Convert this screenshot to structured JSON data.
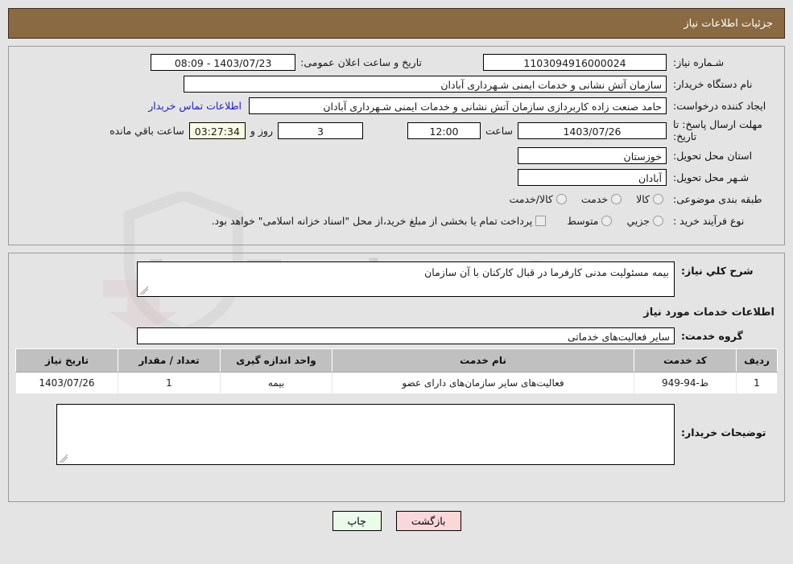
{
  "header": {
    "title": "جزئیات اطلاعات نیاز"
  },
  "form": {
    "need_number_label": "شـماره نیاز:",
    "need_number_value": "1103094916000024",
    "announce_label": "تاریخ و ساعت اعلان عمومی:",
    "announce_value": "1403/07/23 - 08:09",
    "buyer_org_label": "نام دستگاه خریدار:",
    "buyer_org_value": "سازمان آتش نشانی و خدمات ایمنی شـهرداری آبادان",
    "creator_label": "ایجاد کننده درخواست:",
    "creator_value": "حامد صنعت زاده کاربردازی سازمان آتش نشانی و خدمات ایمنی شـهرداری آبادان",
    "contact_link": "اطلاعات تماس خریدار",
    "deadline_label": "مهلت ارسال پاسخ: تا تاریخ:",
    "deadline_date": "1403/07/26",
    "hour_label": "ساعت",
    "deadline_time": "12:00",
    "days_value": "3",
    "days_label": "روز و",
    "countdown_value": "03:27:34",
    "remaining_label": "ساعت باقي مانده",
    "province_label": "استان محل تحویل:",
    "province_value": "خوزستان",
    "city_label": "شـهر محل تحویل:",
    "city_value": "آبادان",
    "category_label": "طبقه بندی موضوعی:",
    "category_options": [
      {
        "label": "کالا",
        "selected": false
      },
      {
        "label": "خدمت",
        "selected": false
      },
      {
        "label": "کالا/خدمت",
        "selected": false
      }
    ],
    "process_label": "نوع فرآیند خرید :",
    "process_options": [
      {
        "label": "جزیي",
        "selected": false
      },
      {
        "label": "متوسط",
        "selected": false
      }
    ],
    "treasury_checkbox_label": "پرداخت تمام یا بخشی از مبلغ خرید،از محل \"اسناد خزانه اسلامی\" خواهد بود.",
    "treasury_checked": false
  },
  "description": {
    "label": "شرح کلي نیاز:",
    "value": "بیمه مسئولیت مدنی کارفرما در قبال کارکنان با آن سازمان"
  },
  "services": {
    "section_title": "اطلاعات خدمات مورد نیاز",
    "group_label": "گروه خدمت:",
    "group_value": "سایر فعالیت‌های خدماتی",
    "columns": [
      "ردیف",
      "کد خدمت",
      "نام خدمت",
      "واحد اندازه گیری",
      "تعداد / مقدار",
      "تاریخ نیاز"
    ],
    "rows": [
      {
        "index": "1",
        "code": "ط-94-949",
        "name": "فعالیت‌های سایر سازمان‌های دارای عضو",
        "unit": "بیمه",
        "quantity": "1",
        "date": "1403/07/26"
      }
    ]
  },
  "buyer_notes": {
    "label": "توضیحات خریدار:",
    "value": ""
  },
  "footer": {
    "print_label": "چاپ",
    "back_label": "بازگشت"
  },
  "watermark": {
    "text": "AnaTender.net"
  },
  "colors": {
    "header_bg": "#8a6a42",
    "page_bg": "#e4e4e4",
    "link": "#2020cc",
    "table_header_bg": "#c0c0c0",
    "countdown_bg": "#fbfbe4",
    "print_btn_bg": "#eafbea",
    "back_btn_bg": "#fbd8d8"
  }
}
